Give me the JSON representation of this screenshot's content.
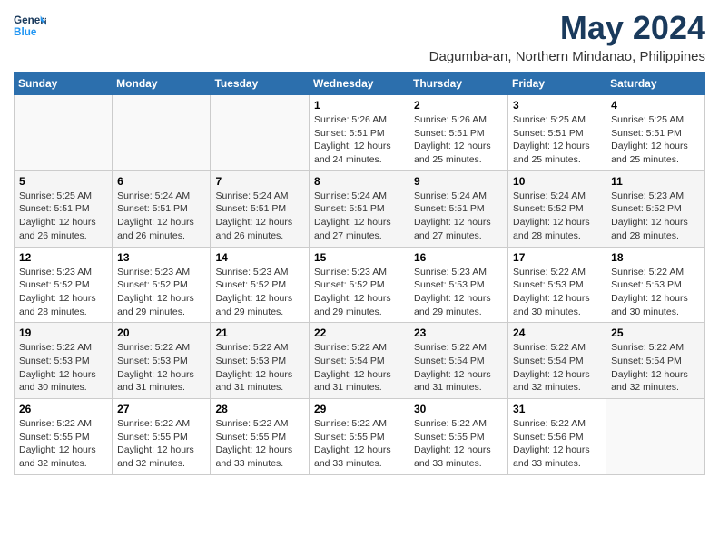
{
  "header": {
    "logo_line1": "General",
    "logo_line2": "Blue",
    "month": "May 2024",
    "location": "Dagumba-an, Northern Mindanao, Philippines"
  },
  "weekdays": [
    "Sunday",
    "Monday",
    "Tuesday",
    "Wednesday",
    "Thursday",
    "Friday",
    "Saturday"
  ],
  "weeks": [
    [
      {
        "day": "",
        "info": ""
      },
      {
        "day": "",
        "info": ""
      },
      {
        "day": "",
        "info": ""
      },
      {
        "day": "1",
        "info": "Sunrise: 5:26 AM\nSunset: 5:51 PM\nDaylight: 12 hours\nand 24 minutes."
      },
      {
        "day": "2",
        "info": "Sunrise: 5:26 AM\nSunset: 5:51 PM\nDaylight: 12 hours\nand 25 minutes."
      },
      {
        "day": "3",
        "info": "Sunrise: 5:25 AM\nSunset: 5:51 PM\nDaylight: 12 hours\nand 25 minutes."
      },
      {
        "day": "4",
        "info": "Sunrise: 5:25 AM\nSunset: 5:51 PM\nDaylight: 12 hours\nand 25 minutes."
      }
    ],
    [
      {
        "day": "5",
        "info": "Sunrise: 5:25 AM\nSunset: 5:51 PM\nDaylight: 12 hours\nand 26 minutes."
      },
      {
        "day": "6",
        "info": "Sunrise: 5:24 AM\nSunset: 5:51 PM\nDaylight: 12 hours\nand 26 minutes."
      },
      {
        "day": "7",
        "info": "Sunrise: 5:24 AM\nSunset: 5:51 PM\nDaylight: 12 hours\nand 26 minutes."
      },
      {
        "day": "8",
        "info": "Sunrise: 5:24 AM\nSunset: 5:51 PM\nDaylight: 12 hours\nand 27 minutes."
      },
      {
        "day": "9",
        "info": "Sunrise: 5:24 AM\nSunset: 5:51 PM\nDaylight: 12 hours\nand 27 minutes."
      },
      {
        "day": "10",
        "info": "Sunrise: 5:24 AM\nSunset: 5:52 PM\nDaylight: 12 hours\nand 28 minutes."
      },
      {
        "day": "11",
        "info": "Sunrise: 5:23 AM\nSunset: 5:52 PM\nDaylight: 12 hours\nand 28 minutes."
      }
    ],
    [
      {
        "day": "12",
        "info": "Sunrise: 5:23 AM\nSunset: 5:52 PM\nDaylight: 12 hours\nand 28 minutes."
      },
      {
        "day": "13",
        "info": "Sunrise: 5:23 AM\nSunset: 5:52 PM\nDaylight: 12 hours\nand 29 minutes."
      },
      {
        "day": "14",
        "info": "Sunrise: 5:23 AM\nSunset: 5:52 PM\nDaylight: 12 hours\nand 29 minutes."
      },
      {
        "day": "15",
        "info": "Sunrise: 5:23 AM\nSunset: 5:52 PM\nDaylight: 12 hours\nand 29 minutes."
      },
      {
        "day": "16",
        "info": "Sunrise: 5:23 AM\nSunset: 5:53 PM\nDaylight: 12 hours\nand 29 minutes."
      },
      {
        "day": "17",
        "info": "Sunrise: 5:22 AM\nSunset: 5:53 PM\nDaylight: 12 hours\nand 30 minutes."
      },
      {
        "day": "18",
        "info": "Sunrise: 5:22 AM\nSunset: 5:53 PM\nDaylight: 12 hours\nand 30 minutes."
      }
    ],
    [
      {
        "day": "19",
        "info": "Sunrise: 5:22 AM\nSunset: 5:53 PM\nDaylight: 12 hours\nand 30 minutes."
      },
      {
        "day": "20",
        "info": "Sunrise: 5:22 AM\nSunset: 5:53 PM\nDaylight: 12 hours\nand 31 minutes."
      },
      {
        "day": "21",
        "info": "Sunrise: 5:22 AM\nSunset: 5:53 PM\nDaylight: 12 hours\nand 31 minutes."
      },
      {
        "day": "22",
        "info": "Sunrise: 5:22 AM\nSunset: 5:54 PM\nDaylight: 12 hours\nand 31 minutes."
      },
      {
        "day": "23",
        "info": "Sunrise: 5:22 AM\nSunset: 5:54 PM\nDaylight: 12 hours\nand 31 minutes."
      },
      {
        "day": "24",
        "info": "Sunrise: 5:22 AM\nSunset: 5:54 PM\nDaylight: 12 hours\nand 32 minutes."
      },
      {
        "day": "25",
        "info": "Sunrise: 5:22 AM\nSunset: 5:54 PM\nDaylight: 12 hours\nand 32 minutes."
      }
    ],
    [
      {
        "day": "26",
        "info": "Sunrise: 5:22 AM\nSunset: 5:55 PM\nDaylight: 12 hours\nand 32 minutes."
      },
      {
        "day": "27",
        "info": "Sunrise: 5:22 AM\nSunset: 5:55 PM\nDaylight: 12 hours\nand 32 minutes."
      },
      {
        "day": "28",
        "info": "Sunrise: 5:22 AM\nSunset: 5:55 PM\nDaylight: 12 hours\nand 33 minutes."
      },
      {
        "day": "29",
        "info": "Sunrise: 5:22 AM\nSunset: 5:55 PM\nDaylight: 12 hours\nand 33 minutes."
      },
      {
        "day": "30",
        "info": "Sunrise: 5:22 AM\nSunset: 5:55 PM\nDaylight: 12 hours\nand 33 minutes."
      },
      {
        "day": "31",
        "info": "Sunrise: 5:22 AM\nSunset: 5:56 PM\nDaylight: 12 hours\nand 33 minutes."
      },
      {
        "day": "",
        "info": ""
      }
    ]
  ]
}
